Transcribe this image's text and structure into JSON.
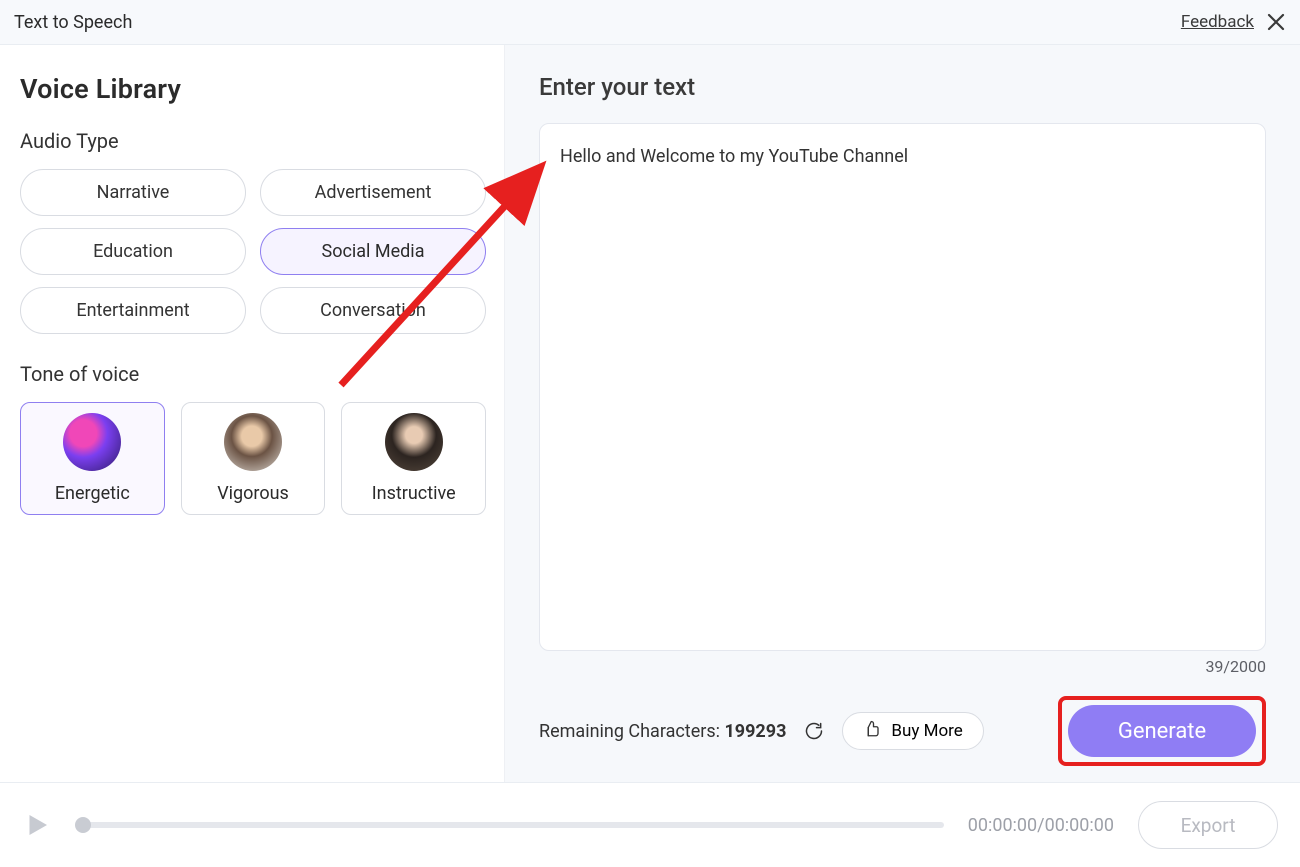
{
  "titlebar": {
    "title": "Text to Speech",
    "feedback": "Feedback"
  },
  "sidebar": {
    "heading": "Voice Library",
    "audioTypeLabel": "Audio Type",
    "audioTypes": [
      {
        "label": "Narrative",
        "selected": false
      },
      {
        "label": "Advertisement",
        "selected": false
      },
      {
        "label": "Education",
        "selected": false
      },
      {
        "label": "Social Media",
        "selected": true
      },
      {
        "label": "Entertainment",
        "selected": false
      },
      {
        "label": "Conversation",
        "selected": false
      }
    ],
    "toneLabel": "Tone of voice",
    "tones": [
      {
        "label": "Energetic",
        "selected": true,
        "avatar": "energetic"
      },
      {
        "label": "Vigorous",
        "selected": false,
        "avatar": "vigorous"
      },
      {
        "label": "Instructive",
        "selected": false,
        "avatar": "instructive"
      }
    ]
  },
  "editor": {
    "heading": "Enter your text",
    "text": "Hello and Welcome to my YouTube Channel",
    "charCount": "39/2000",
    "remainingLabel": "Remaining Characters:",
    "remainingValue": "199293",
    "buyMore": "Buy More",
    "generate": "Generate"
  },
  "player": {
    "time": "00:00:00/00:00:00",
    "export": "Export"
  }
}
